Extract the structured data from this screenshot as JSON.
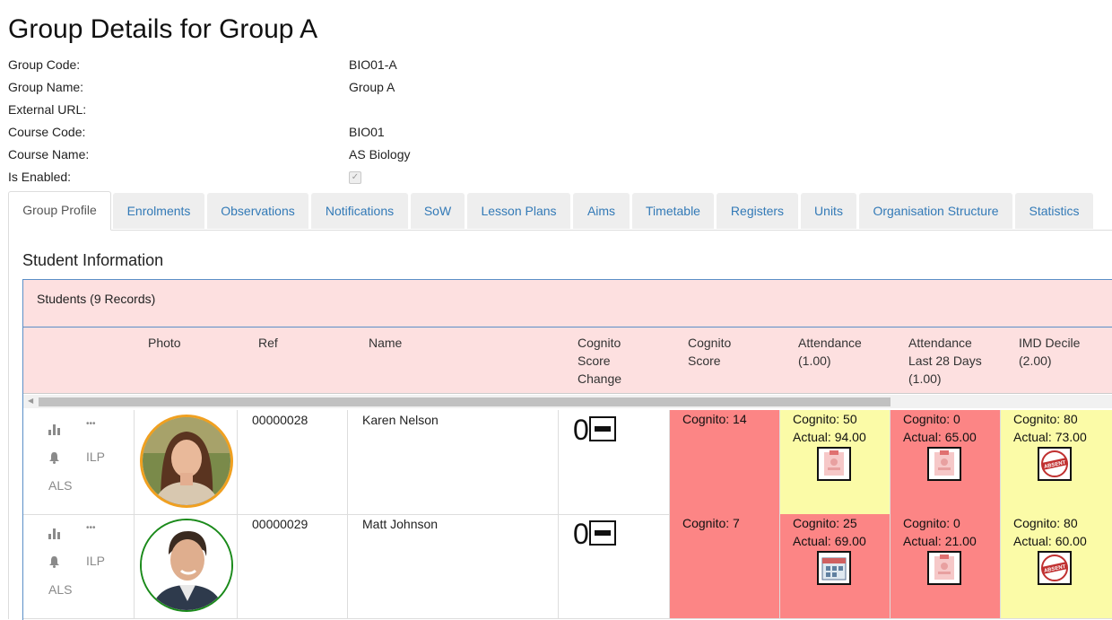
{
  "page": {
    "title": "Group Details for Group A"
  },
  "details": [
    {
      "label": "Group Code:",
      "value": "BIO01-A"
    },
    {
      "label": "Group Name:",
      "value": "Group A"
    },
    {
      "label": "External URL:",
      "value": ""
    },
    {
      "label": "Course Code:",
      "value": "BIO01"
    },
    {
      "label": "Course Name:",
      "value": "AS Biology"
    },
    {
      "label": "Is Enabled:",
      "value": ""
    }
  ],
  "is_enabled_checked": true,
  "tabs": [
    "Group Profile",
    "Enrolments",
    "Observations",
    "Notifications",
    "SoW",
    "Lesson Plans",
    "Aims",
    "Timetable",
    "Registers",
    "Units",
    "Organisation Structure",
    "Statistics"
  ],
  "active_tab": "Group Profile",
  "section": {
    "title": "Student Information"
  },
  "panel": {
    "heading": "Students (9 Records)"
  },
  "columns": {
    "photo": "Photo",
    "ref": "Ref",
    "name": "Name",
    "cognito_change": [
      "Cognito",
      "Score",
      "Change"
    ],
    "cognito_score": [
      "Cognito",
      "Score"
    ],
    "attendance": [
      "Attendance",
      "(1.00)"
    ],
    "attendance28": [
      "Attendance",
      "Last 28 Days",
      "(1.00)"
    ],
    "imd": [
      "IMD Decile",
      "(2.00)"
    ]
  },
  "actions": {
    "ilp": "ILP",
    "als": "ALS",
    "more": "•••"
  },
  "students": [
    {
      "ref": "00000028",
      "name": "Karen Nelson",
      "score_change": "0",
      "avatar_border": "#f0a020",
      "cognito": "Cognito: 14",
      "attendance": {
        "cognito": "Cognito: 50",
        "actual": "Actual: 94.00",
        "icon": "attendance-clipboard-icon"
      },
      "attendance28": {
        "cognito": "Cognito: 0",
        "actual": "Actual: 65.00",
        "icon": "attendance-clipboard-icon"
      },
      "imd": {
        "cognito": "Cognito: 80",
        "actual": "Actual: 73.00",
        "icon": "absent-stamp-icon"
      }
    },
    {
      "ref": "00000029",
      "name": "Matt Johnson",
      "score_change": "0",
      "avatar_border": "#1a8a1a",
      "cognito": "Cognito: 7",
      "attendance": {
        "cognito": "Cognito: 25",
        "actual": "Actual: 69.00",
        "icon": "calendar-icon"
      },
      "attendance28": {
        "cognito": "Cognito: 0",
        "actual": "Actual: 21.00",
        "icon": "attendance-clipboard-icon"
      },
      "imd": {
        "cognito": "Cognito: 80",
        "actual": "Actual: 60.00",
        "icon": "absent-stamp-icon"
      }
    }
  ],
  "absent_stamp_text": "ABSENT",
  "colors": {
    "link": "#337ab7",
    "red_tile": "#fc8585",
    "yellow_tile": "#fbfba7",
    "header_bg": "#fde0e0"
  }
}
